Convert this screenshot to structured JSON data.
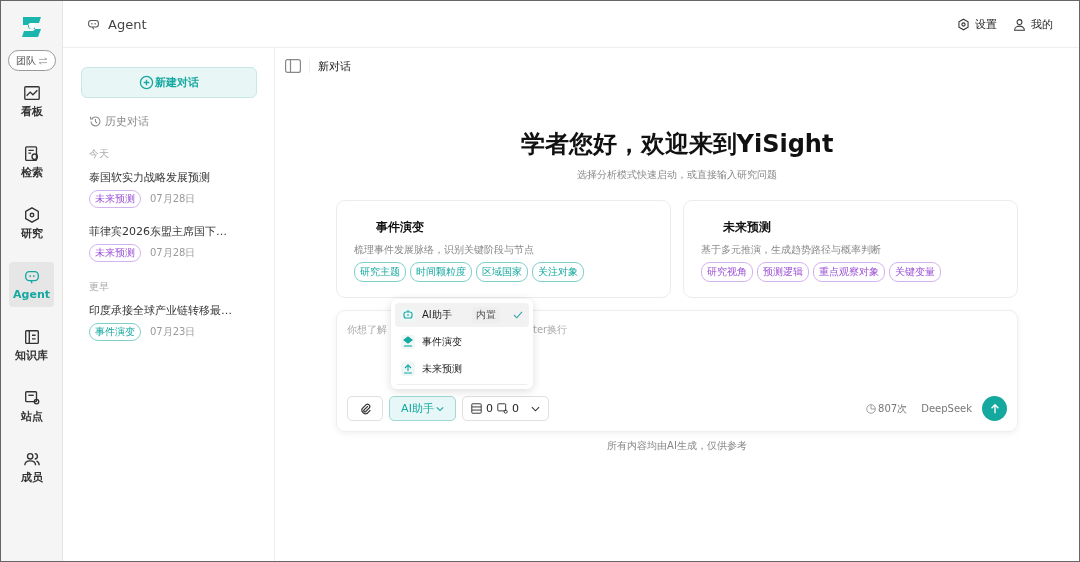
{
  "rail": {
    "team_label": "团队",
    "items": [
      {
        "label": "看板",
        "selected": false
      },
      {
        "label": "检索",
        "selected": false
      },
      {
        "label": "研究",
        "selected": false
      },
      {
        "label": "Agent",
        "selected": true
      },
      {
        "label": "知识库",
        "selected": false
      },
      {
        "label": "站点",
        "selected": false
      },
      {
        "label": "成员",
        "selected": false
      }
    ]
  },
  "header": {
    "title": "Agent",
    "settings": "设置",
    "profile": "我的"
  },
  "history": {
    "new_chat": "新建对话",
    "heading": "历史对话",
    "groups": [
      {
        "label": "今天",
        "items": [
          {
            "title": "泰国软实力战略发展预测",
            "tag": "未来预测",
            "kind": "forecast",
            "date": "07月28日"
          },
          {
            "title": "菲律宾2026东盟主席国下…",
            "tag": "未来预测",
            "kind": "forecast",
            "date": "07月28日"
          }
        ]
      },
      {
        "label": "更早",
        "items": [
          {
            "title": "印度承接全球产业链转移最…",
            "tag": "事件演变",
            "kind": "event",
            "date": "07月23日"
          }
        ]
      }
    ]
  },
  "main": {
    "title": "新对话",
    "welcome": "学者您好，欢迎来到YiSight",
    "subtitle": "选择分析模式快速启动，或直接输入研究问题",
    "cards": [
      {
        "title": "事件演变",
        "kind": "event",
        "desc": "梳理事件发展脉络，识别关键阶段与节点",
        "tags": [
          "研究主题",
          "时间颗粒度",
          "区域国家",
          "关注对象"
        ]
      },
      {
        "title": "未来预测",
        "kind": "forecast",
        "desc": "基于多元推演，生成趋势路径与概率判断",
        "tags": [
          "研究视角",
          "预测逻辑",
          "重点观察对象",
          "关键变量"
        ]
      }
    ],
    "input": {
      "placeholder_start": "你想了解",
      "placeholder_end": "ter换行",
      "mode": "AI助手",
      "kb_count": "0",
      "site_count": "0",
      "usage": "807次",
      "model": "DeepSeek"
    },
    "menu": [
      {
        "label": "AI助手",
        "badge": "内置",
        "selected": true
      },
      {
        "label": "事件演变",
        "selected": false
      },
      {
        "label": "未来预测",
        "selected": false
      }
    ],
    "footer": "所有内容均由AI生成，仅供参考"
  }
}
